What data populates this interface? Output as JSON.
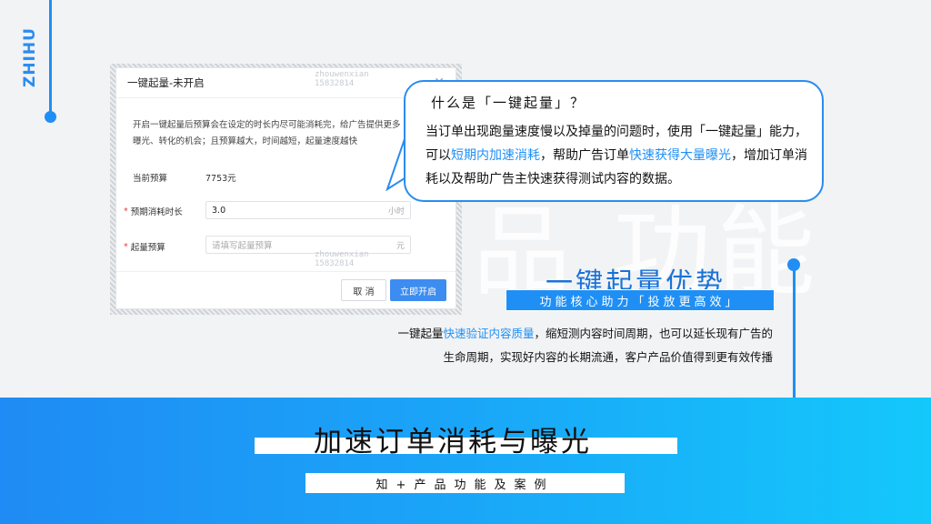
{
  "brand": {
    "logo_text": "ZHIHU"
  },
  "background": {
    "watermark_text": "品 功能"
  },
  "modal": {
    "title": "一键起量-未开启",
    "description": "开启一键起量后预算会在设定的时长内尽可能消耗完，给广告提供更多曝光、转化的机会；且预算越大，时间越短，起量速度越快",
    "current_budget_label": "当前预算",
    "current_budget_value": "7753元",
    "duration_label": "预期消耗时长",
    "duration_value": "3.0",
    "duration_unit": "小时",
    "budget_label": "起量预算",
    "budget_placeholder": "请填写起量预算",
    "budget_unit": "元",
    "required_mark": "*",
    "cancel_label": "取 消",
    "confirm_label": "立即开启",
    "watermark_lines": [
      "zhouwenxian",
      "15832814"
    ]
  },
  "bubble": {
    "title": "什么是「一键起量」？",
    "body_part1": "当订单出现跑量速度慢以及掉量的问题时，使用「一键起量」能力，可以",
    "body_highlight1": "短期内加速消耗",
    "body_part2": "，帮助广告订单",
    "body_highlight2": "快速获得大量曝光",
    "body_part3": "，增加订单消耗以及帮助广告主快速获得测试内容的数据。"
  },
  "right": {
    "title": "一键起量优势",
    "band_text": "功能核心助力「投放更高效」",
    "desc_part1": "一键起量",
    "desc_highlight": "快速验证内容质量",
    "desc_part2": "，缩短测内容时间周期，也可以延长现有广告的",
    "desc_line2": "生命周期，实现好内容的长期流通，客户产品价值得到更有效传播"
  },
  "bottom": {
    "title": "加速订单消耗与曝光",
    "subtitle": "知+产品功能及案例"
  },
  "colors": {
    "accent": "#1f8ff5",
    "primary_button": "#3d8cf0",
    "required": "#e0413b"
  }
}
